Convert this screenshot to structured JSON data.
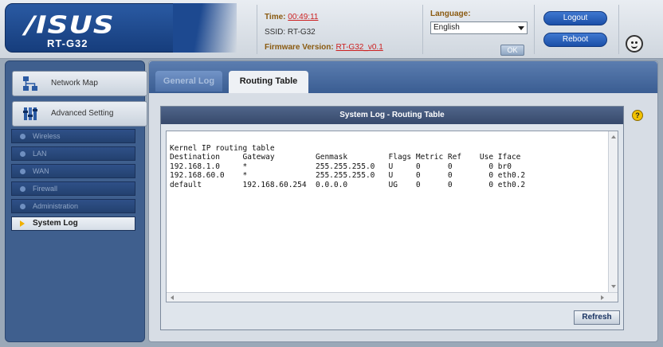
{
  "header": {
    "brand": "/ISUS",
    "model": "RT-G32",
    "time_label": "Time:",
    "time_value": "00:49:11",
    "ssid_label": "SSID:",
    "ssid_value": "RT-G32",
    "firmware_label": "Firmware Version:",
    "firmware_value": "RT-G32_v0.1",
    "language_label": "Language:",
    "language_value": "English",
    "ok_label": "OK",
    "logout_label": "Logout",
    "reboot_label": "Reboot"
  },
  "sidebar": {
    "main_items": [
      {
        "label": "Network Map",
        "icon": "network-map-icon"
      },
      {
        "label": "Advanced Setting",
        "icon": "advanced-setting-icon"
      }
    ],
    "sub_items": [
      {
        "label": "Wireless",
        "active": false
      },
      {
        "label": "LAN",
        "active": false
      },
      {
        "label": "WAN",
        "active": false
      },
      {
        "label": "Firewall",
        "active": false
      },
      {
        "label": "Administration",
        "active": false
      },
      {
        "label": "System Log",
        "active": true
      }
    ]
  },
  "main": {
    "tabs": [
      {
        "label": "General Log",
        "active": false
      },
      {
        "label": "Routing Table",
        "active": true
      }
    ],
    "help_label": "?",
    "panel_title": "System Log - Routing Table",
    "log_lines": [
      "Kernel IP routing table",
      "Destination     Gateway         Genmask         Flags Metric Ref    Use Iface",
      "192.168.1.0     *               255.255.255.0   U     0      0        0 br0",
      "192.168.60.0    *               255.255.255.0   U     0      0        0 eth0.2",
      "default         192.168.60.254  0.0.0.0         UG    0      0        0 eth0.2"
    ],
    "refresh_label": "Refresh"
  },
  "colors": {
    "brand_blue": "#1d4990",
    "sidebar_bg": "#3f5f8e",
    "active_marker": "#f0b000"
  }
}
